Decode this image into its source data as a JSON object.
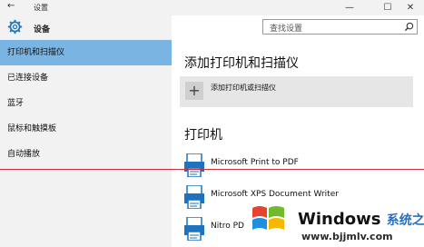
{
  "window": {
    "back_glyph": "←",
    "title": "设置",
    "minimize_glyph": "—",
    "maximize_glyph": "☐",
    "close_glyph": "✕"
  },
  "header": {
    "app_title": "设备",
    "icon": "gear-icon",
    "search": {
      "placeholder": "查找设置",
      "icon": "search-icon"
    }
  },
  "sidebar": {
    "items": [
      {
        "label": "打印机和扫描仪",
        "active": true
      },
      {
        "label": "已连接设备",
        "active": false
      },
      {
        "label": "蓝牙",
        "active": false
      },
      {
        "label": "鼠标和触摸板",
        "active": false
      },
      {
        "label": "自动播放",
        "active": false
      }
    ]
  },
  "main": {
    "section_add_title": "添加打印机和扫描仪",
    "add_button_label": "添加打印机或扫描仪",
    "add_button_icon": "plus-icon",
    "section_printers_title": "打印机",
    "printers": [
      {
        "name": "Microsoft Print to PDF",
        "icon": "printer-icon"
      },
      {
        "name": "Microsoft XPS Document Writer",
        "icon": "printer-icon"
      },
      {
        "name": "Nitro PD",
        "icon": "printer-icon"
      }
    ]
  },
  "watermark": {
    "brand": "Windows",
    "brand_suffix": "系统之家",
    "url": "www.bjjmlv.com",
    "icon": "windows-logo-icon"
  },
  "colors": {
    "active_nav": "#79b4e3",
    "accent_blue": "#1e73be",
    "red_line": "#d0303a"
  }
}
